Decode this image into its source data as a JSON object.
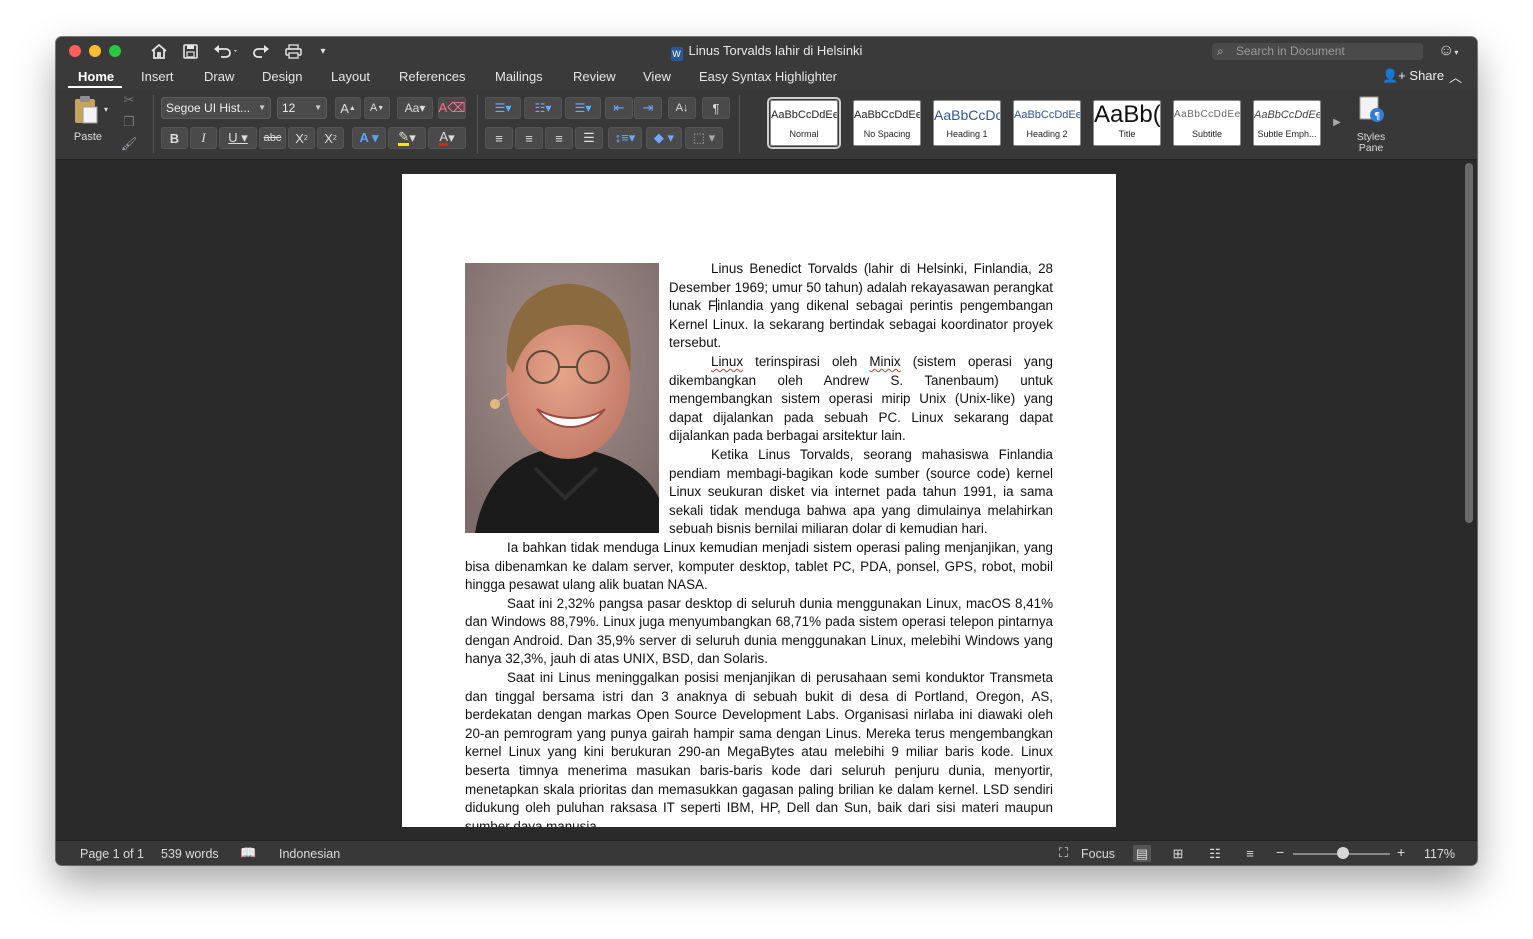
{
  "window": {
    "title": "Linus Torvalds lahir di Helsinki",
    "search_placeholder": "Search in Document"
  },
  "quick_access": [
    "home-icon",
    "save-icon",
    "undo-icon",
    "redo-icon",
    "print-icon",
    "customize-icon"
  ],
  "tabs": [
    "Home",
    "Insert",
    "Draw",
    "Design",
    "Layout",
    "References",
    "Mailings",
    "Review",
    "View",
    "Easy Syntax Highlighter"
  ],
  "active_tab": "Home",
  "share_label": "Share",
  "ribbon": {
    "paste_label": "Paste",
    "font_name": "Segoe UI Hist...",
    "font_size": "12",
    "styles": [
      {
        "sample": "AaBbCcDdEe",
        "name": "Normal"
      },
      {
        "sample": "AaBbCcDdEe",
        "name": "No Spacing"
      },
      {
        "sample": "AaBbCcDc",
        "name": "Heading 1"
      },
      {
        "sample": "AaBbCcDdEe",
        "name": "Heading 2"
      },
      {
        "sample": "AaBb(",
        "name": "Title"
      },
      {
        "sample": "AaBbCcDdEe",
        "name": "Subtitle"
      },
      {
        "sample": "AaBbCcDdEe",
        "name": "Subtle Emph..."
      }
    ],
    "styles_pane_label": "Styles Pane"
  },
  "document": {
    "p1": "Linus Benedict Torvalds (lahir di Helsinki, Finlandia, 28 Desember 1969; umur 50 tahun) adalah rekayasawan perangkat lunak F",
    "p1b": "inlandia yang dikenal sebagai perintis pengembangan Kernel Linux. Ia sekarang bertindak sebagai koordinator proyek tersebut.",
    "p2_w1": "Linux",
    "p2_mid": " terinspirasi oleh ",
    "p2_w2": "Minix",
    "p2_rest": " (sistem operasi yang dikembangkan oleh Andrew S. Tanenbaum) untuk mengembangkan sistem operasi mirip Unix (Unix-like) yang dapat dijalankan pada sebuah PC. Linux sekarang dapat dijalankan pada berbagai arsitektur lain.",
    "p3": "Ketika Linus Torvalds, seorang mahasiswa Finlandia pendiam membagi-bagikan kode sumber (source code) kernel Linux seukuran disket via internet pada tahun 1991, ia sama sekali tidak menduga bahwa apa yang dimulainya melahirkan sebuah bisnis bernilai miliaran dolar di kemudian hari.",
    "p4": "Ia bahkan tidak menduga Linux kemudian menjadi sistem operasi paling menjanjikan, yang bisa dibenamkan ke dalam server, komputer desktop, tablet PC, PDA, ponsel, GPS, robot, mobil hingga pesawat ulang alik buatan NASA.",
    "p5": "Saat ini 2,32% pangsa pasar desktop di seluruh dunia menggunakan Linux, macOS 8,41% dan Windows 88,79%. Linux juga menyumbangkan 68,71% pada sistem operasi telepon pintarnya dengan Android. Dan 35,9% server di seluruh dunia menggunakan Linux, melebihi Windows yang hanya 32,3%, jauh di atas UNIX, BSD, dan Solaris.",
    "p6": "Saat ini Linus meninggalkan posisi menjanjikan di perusahaan semi konduktor Transmeta dan tinggal bersama istri dan 3 anaknya di sebuah bukit di desa di Portland, Oregon, AS, berdekatan dengan markas Open Source Development Labs. Organisasi nirlaba ini diawaki oleh 20-an pemrogram yang punya gairah hampir sama dengan Linus. Mereka terus mengembangkan kernel Linux yang kini berukuran 290-an MegaBytes atau melebihi 9 miliar baris kode. Linux beserta timnya menerima masukan baris-baris kode dari seluruh penjuru dunia, menyortir, menetapkan skala prioritas dan memasukkan gagasan paling brilian ke dalam kernel. LSD sendiri didukung oleh puluhan raksasa IT seperti IBM, HP, Dell dan Sun, baik dari sisi materi maupun sumber daya manusia."
  },
  "status": {
    "page": "Page 1 of 1",
    "words": "539 words",
    "language": "Indonesian",
    "focus": "Focus",
    "zoom": "117%",
    "zoom_level_percent": 117
  }
}
